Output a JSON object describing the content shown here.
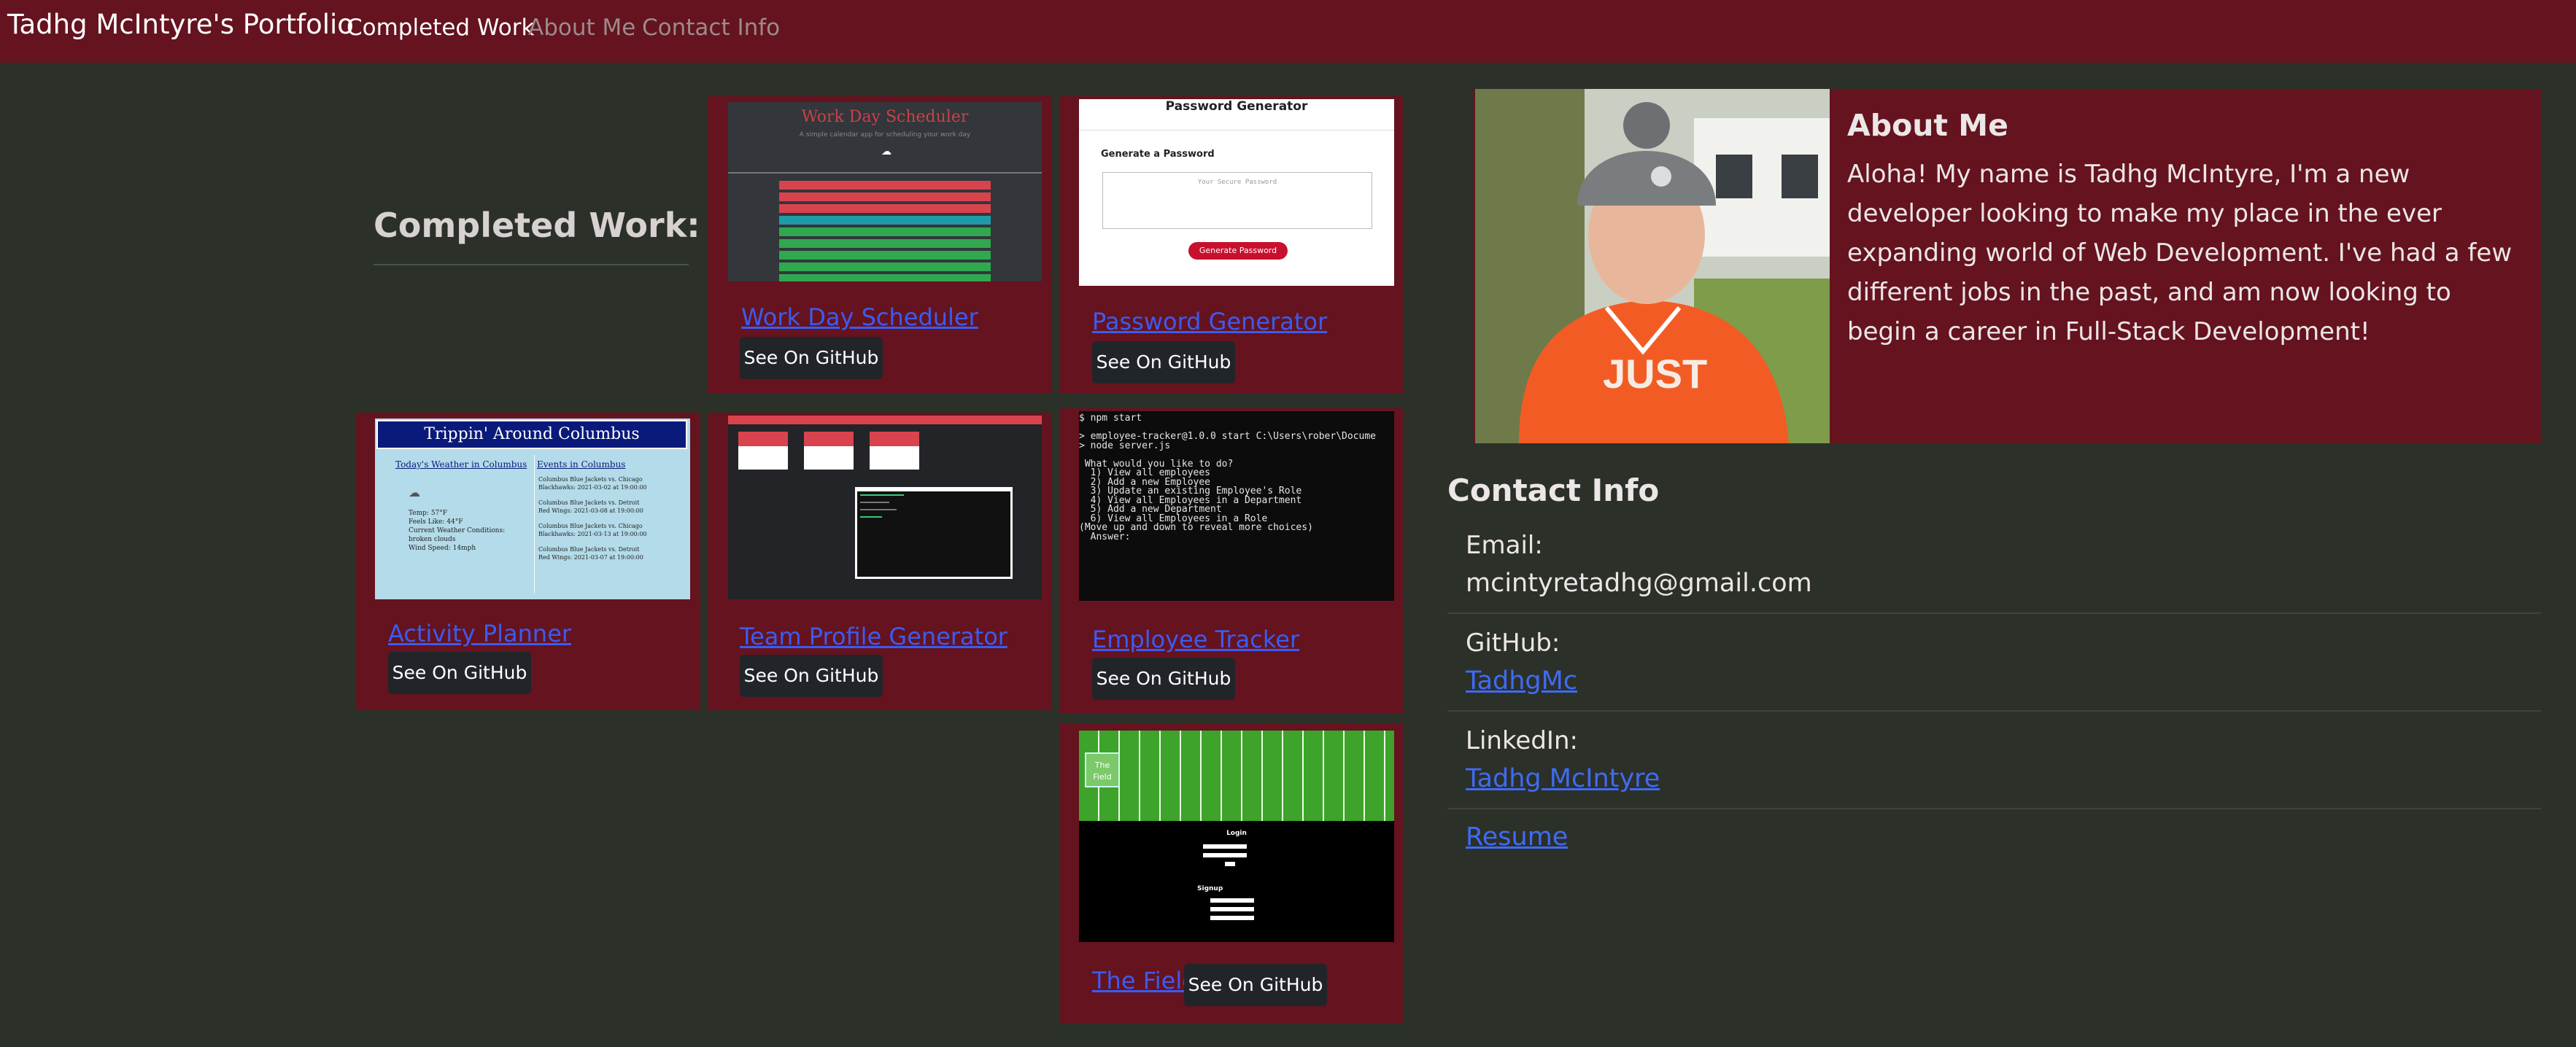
{
  "nav": {
    "brand": "Tadhg McIntyre's Portfolio",
    "links": [
      "Completed Work",
      "About Me",
      "Contact Info"
    ]
  },
  "work": {
    "heading": "Completed Work:",
    "button_label": "See On GitHub",
    "projects": [
      {
        "name": "Work Day Scheduler"
      },
      {
        "name": "Password Generator"
      },
      {
        "name": "Activity Planner"
      },
      {
        "name": "Team Profile Generator"
      },
      {
        "name": "Employee Tracker"
      },
      {
        "name": "The Field"
      }
    ]
  },
  "thumbs": {
    "scheduler": {
      "title": "Work Day Scheduler",
      "subtitle": "A simple calendar app for scheduling your work day"
    },
    "password": {
      "title": "Password Generator",
      "heading": "Generate a Password",
      "placeholder": "Your Secure Password",
      "button": "Generate Password"
    },
    "activity": {
      "title": "Trippin' Around Columbus",
      "weather_heading": "Today's Weather in Columbus",
      "events_heading": "Events in Columbus",
      "weather": [
        "Temp: 57°F",
        "Feels Like: 44°F",
        "Current Weather Conditions:",
        "broken clouds",
        "Wind Speed: 14mph"
      ],
      "events": [
        "Columbus Blue Jackets vs. Chicago",
        "Blackhawks: 2021-03-02 at 19:00:00",
        "Columbus Blue Jackets vs. Detroit",
        "Red Wings: 2021-03-08 at 19:00:00",
        "Columbus Blue Jackets vs. Chicago",
        "Blackhawks: 2021-03-13 at 19:00:00",
        "Columbus Blue Jackets vs. Detroit",
        "Red Wings: 2021-03-07 at 19:00:00"
      ]
    },
    "tracker": {
      "terminal": "$ npm start\n\n> employee-tracker@1.0.0 start C:\\Users\\rober\\Docume\n> node server.js\n\n What would you like to do?\n  1) View all employees\n  2) Add a new Employee\n  3) Update an existing Employee's Role\n  4) View all Employees in a Department\n  5) Add a new Department\n  6) View all Employees in a Role\n(Move up and down to reveal more choices)\n  Answer:"
    },
    "field": {
      "logo": "The Field",
      "login": "Login",
      "signup": "Signup"
    }
  },
  "about": {
    "title": "About Me",
    "text": "Aloha! My name is Tadhg McIntyre, I'm a new developer looking to make my place in the ever expanding world of Web Development. I've had a few different jobs in the past, and am now looking to begin a career in Full-Stack Development!"
  },
  "contact": {
    "title": "Contact Info",
    "email_label": "Email:",
    "email": "mcintyretadhg@gmail.com",
    "github_label": "GitHub:",
    "github": "TadhgMc",
    "linkedin_label": "LinkedIn:",
    "linkedin": "Tadhg McIntyre",
    "resume": "Resume"
  },
  "colors": {
    "background": "#2b3029",
    "card": "#64131f",
    "link": "#3b5bf2",
    "button": "#212529"
  }
}
